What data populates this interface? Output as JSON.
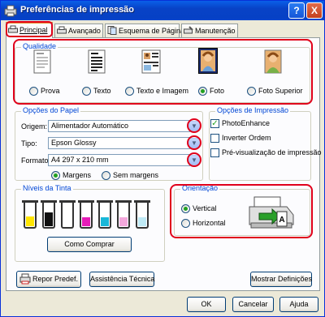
{
  "window": {
    "title": "Preferências de impressão"
  },
  "titlebar": {
    "help": "?",
    "close": "X"
  },
  "tabs": [
    {
      "label": "Principal",
      "icon": "printer-icon",
      "active": true
    },
    {
      "label": "Avançado",
      "icon": "printer-icon"
    },
    {
      "label": "Esquema de Página",
      "icon": "page-layout-icon"
    },
    {
      "label": "Manutenção",
      "icon": "maintenance-icon"
    }
  ],
  "quality": {
    "title": "Qualidade",
    "options": [
      {
        "label": "Prova",
        "selected": false,
        "icon": "draft-doc-icon"
      },
      {
        "label": "Texto",
        "selected": false,
        "icon": "text-doc-icon"
      },
      {
        "label": "Texto e Imagem",
        "selected": false,
        "icon": "text-image-doc-icon"
      },
      {
        "label": "Foto",
        "selected": true,
        "icon": "photo-icon"
      },
      {
        "label": "Foto Superior",
        "selected": false,
        "icon": "best-photo-icon"
      }
    ]
  },
  "paper": {
    "title": "Opções do Papel",
    "source_label": "Origem:",
    "source_value": "Alimentador Automático",
    "type_label": "Tipo:",
    "type_value": "Epson Glossy",
    "format_label": "Formato:",
    "format_value": "A4 297 x 210 mm",
    "margins_label": "Margens",
    "borderless_label": "Sem margens",
    "margins_selected": true
  },
  "print_options": {
    "title": "Opções de Impressão",
    "photoenhance_label": "PhotoEnhance",
    "photoenhance_checked": true,
    "reverse_order_label": "Inverter Ordem",
    "reverse_order_checked": false,
    "preview_label": "Pré-visualização de impressão",
    "preview_checked": false
  },
  "ink": {
    "title": "Níveis da Tinta",
    "cartridges": [
      {
        "color": "#ffe500",
        "level": 0.4
      },
      {
        "color": "#111111",
        "level": 0.55
      },
      {
        "color": "#e5e5e5",
        "level": 0.0
      },
      {
        "color": "#e61cb8",
        "level": 0.35
      },
      {
        "color": "#18b7d8",
        "level": 0.35
      },
      {
        "color": "#f4a8dc",
        "level": 0.35
      },
      {
        "color": "#bfeaf5",
        "level": 0.35
      }
    ],
    "buy_button": "Como Comprar"
  },
  "orientation": {
    "title": "Orientação",
    "portrait_label": "Vertical",
    "landscape_label": "Horizontal",
    "portrait_selected": true
  },
  "buttons": {
    "restore": "Repor Predef.",
    "support": "Assistência Técnica",
    "show_settings": "Mostrar Definições",
    "ok": "OK",
    "cancel": "Cancelar",
    "help": "Ajuda"
  },
  "colors": {
    "accent": "#0046d5",
    "highlight": "#e0001b",
    "title_bar": "#0842c6"
  }
}
